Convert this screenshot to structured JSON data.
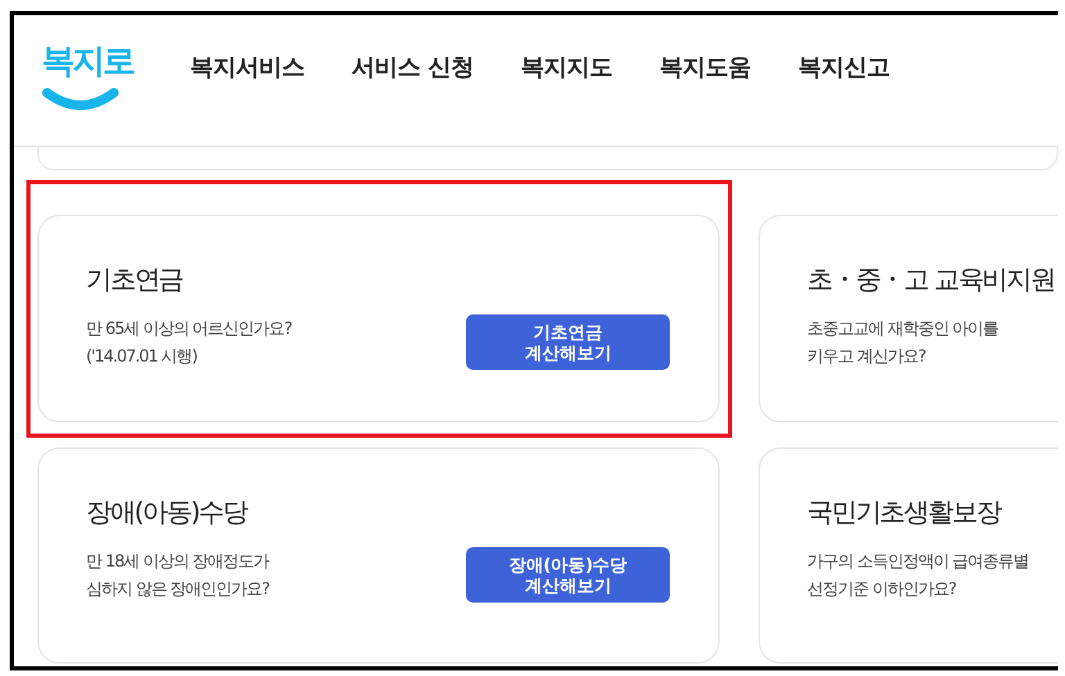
{
  "logo": {
    "text": "복지로"
  },
  "nav": [
    {
      "label": "복지서비스"
    },
    {
      "label": "서비스 신청"
    },
    {
      "label": "복지지도"
    },
    {
      "label": "복지도움"
    },
    {
      "label": "복지신고"
    }
  ],
  "cards": [
    {
      "title": "기초연금",
      "description": [
        "만 65세 이상의 어르신인가요?",
        "('14.07.01 시행)"
      ],
      "button": [
        "기초연금",
        "계산해보기"
      ],
      "highlighted": true
    },
    {
      "title": "초・중・고 교육비지원",
      "description": [
        "초중고교에 재학중인 아이를",
        "키우고 계신가요?"
      ],
      "highlighted": false
    },
    {
      "title": "장애(아동)수당",
      "description": [
        "만 18세 이상의 장애정도가",
        "심하지 않은 장애인인가요?"
      ],
      "button": [
        "장애(아동)수당",
        "계산해보기"
      ],
      "highlighted": false
    },
    {
      "title": "국민기초생활보장",
      "description": [
        "가구의 소득인정액이 급여종류별",
        "선정기준 이하인가요?"
      ],
      "highlighted": false
    }
  ]
}
